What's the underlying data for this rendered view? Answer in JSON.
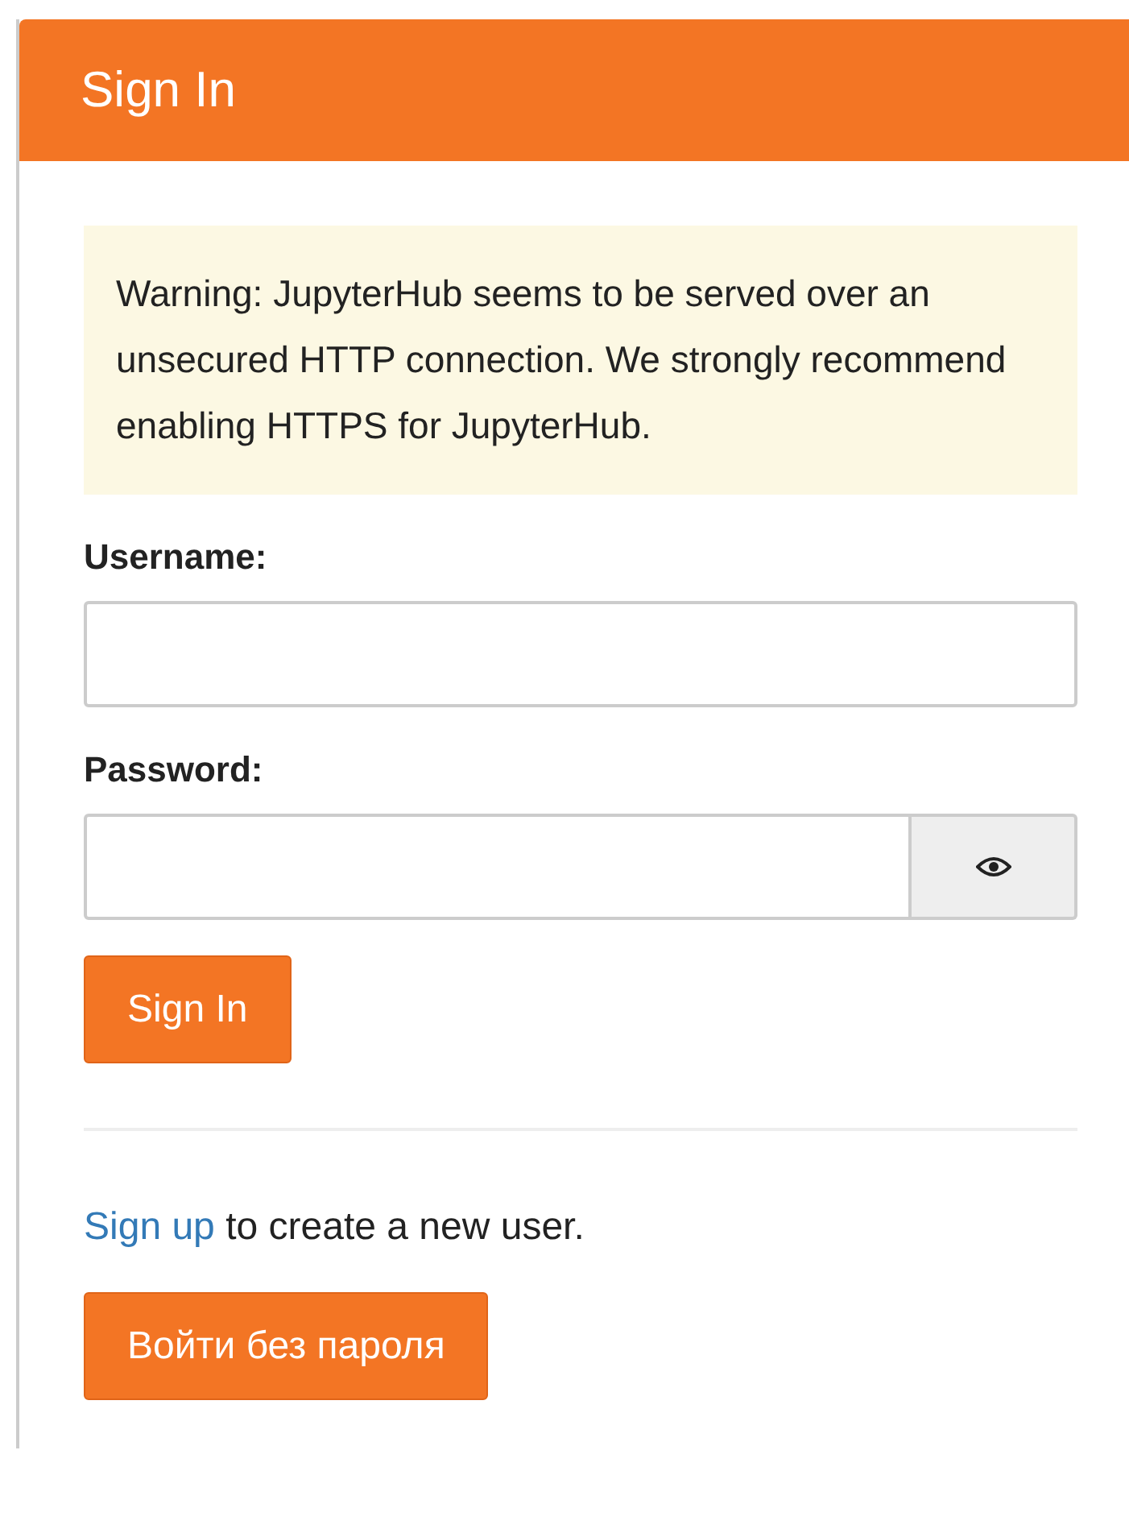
{
  "header": {
    "title": "Sign In"
  },
  "warning": "Warning: JupyterHub seems to be served over an unsecured HTTP connection. We strongly recommend enabling HTTPS for JupyterHub.",
  "username": {
    "label": "Username:"
  },
  "password": {
    "label": "Password:"
  },
  "submit": "Sign In",
  "signup": {
    "link": "Sign up",
    "text": " to create a new user."
  },
  "passwordless_button": "Войти без пароля"
}
